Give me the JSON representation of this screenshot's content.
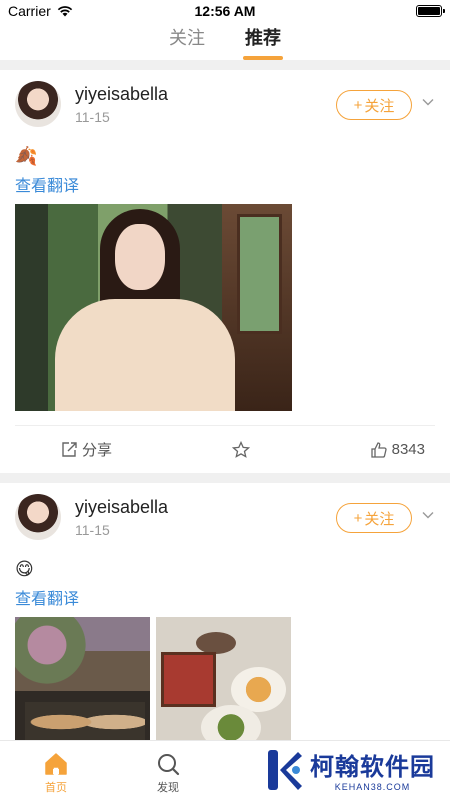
{
  "status": {
    "carrier": "Carrier",
    "time": "12:56 AM"
  },
  "top_tabs": [
    {
      "label": "关注",
      "active": false
    },
    {
      "label": "推荐",
      "active": true
    }
  ],
  "posts": [
    {
      "username": "yiyeisabella",
      "date": "11-15",
      "follow_label": "关注",
      "emoji": "🍂",
      "translate": "查看翻译",
      "actions": {
        "share_label": "分享",
        "like_count": "8343"
      }
    },
    {
      "username": "yiyeisabella",
      "date": "11-15",
      "follow_label": "关注",
      "emoji": "😋",
      "translate": "查看翻译"
    }
  ],
  "tab_bar": [
    {
      "label": "首页",
      "icon": "home-icon",
      "active": true
    },
    {
      "label": "发现",
      "icon": "search-icon",
      "active": false
    }
  ],
  "watermark": {
    "title": "柯翰软件园",
    "subtitle": "KEHAN38.COM"
  },
  "colors": {
    "accent": "#f5a33b",
    "link": "#3a8ad8",
    "watermark": "#1a3a9a"
  }
}
